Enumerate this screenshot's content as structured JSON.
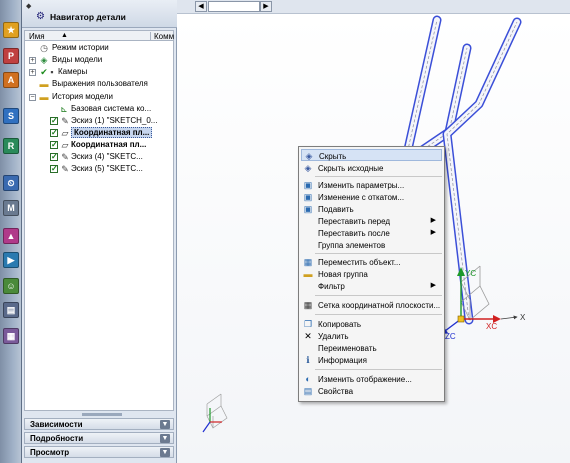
{
  "navigator": {
    "title": "Навигатор детали",
    "columns": {
      "name": "Имя",
      "comment": "Комм"
    },
    "tree": [
      "Режим истории",
      "Виды модели",
      "Камеры",
      "Выражения пользователя",
      "История модели",
      "Базовая система ко...",
      "Эскиз (1) \"SKETCH_0...",
      "Координатная пл...",
      "Координатная пл...",
      "Эскиз (4) \"SKETC...",
      "Эскиз (5) \"SKETC..."
    ],
    "sections": [
      "Зависимости",
      "Подробности",
      "Просмотр"
    ]
  },
  "context_menu": {
    "items": [
      "Скрыть",
      "Скрыть исходные",
      "Изменить параметры...",
      "Изменение с откатом...",
      "Подавить",
      "Переставить перед",
      "Переставить после",
      "Группа элементов",
      "Переместить объект...",
      "Новая группа",
      "Фильтр",
      "Сетка координатной плоскости...",
      "Копировать",
      "Удалить",
      "Переименовать",
      "Информация",
      "Изменить отображение...",
      "Свойства"
    ]
  },
  "viewport": {
    "axis_labels": {
      "x": "X",
      "xc": "XC",
      "yc": "YC",
      "zc": "ZC"
    }
  },
  "colors": {
    "accent_blue": "#3b4fd8",
    "plane_orange": "#f08a2a",
    "axis_red": "#d02020",
    "axis_green": "#1c9a2a",
    "axis_blue": "#2030d0"
  }
}
